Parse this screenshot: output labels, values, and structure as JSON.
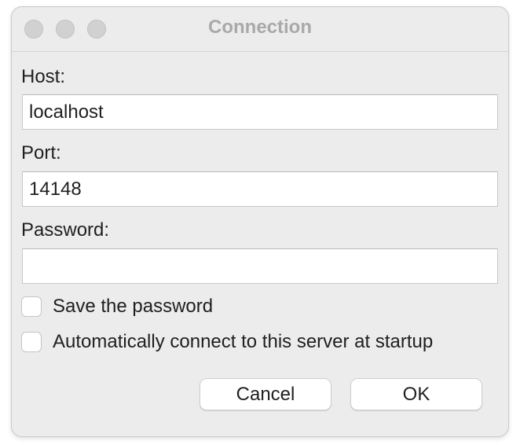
{
  "window": {
    "title": "Connection"
  },
  "host": {
    "label": "Host:",
    "value": "localhost"
  },
  "port": {
    "label": "Port:",
    "value": "14148"
  },
  "password": {
    "label": "Password:",
    "value": ""
  },
  "options": {
    "save_password": {
      "label": "Save the password",
      "checked": false
    },
    "auto_connect": {
      "label": "Automatically connect to this server at startup",
      "checked": false
    }
  },
  "buttons": {
    "cancel": "Cancel",
    "ok": "OK"
  }
}
